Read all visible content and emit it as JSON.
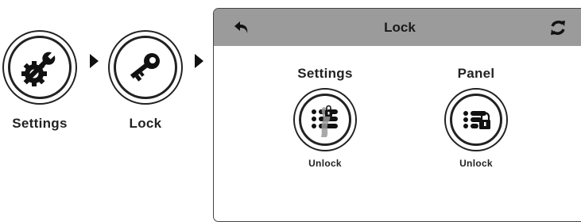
{
  "nav": {
    "steps": [
      {
        "label": "Settings",
        "icon": "wrench-gear-icon"
      },
      {
        "label": "Lock",
        "icon": "key-icon"
      }
    ]
  },
  "window": {
    "title": "Lock",
    "back_icon": "back-arrow-icon",
    "refresh_icon": "refresh-icon",
    "header_color": "#9b9b9b"
  },
  "options": [
    {
      "title": "Settings",
      "caption": "Unlock",
      "icon": "settings-lock-icon"
    },
    {
      "title": "Panel",
      "caption": "Unlock",
      "icon": "panel-lock-icon"
    }
  ]
}
